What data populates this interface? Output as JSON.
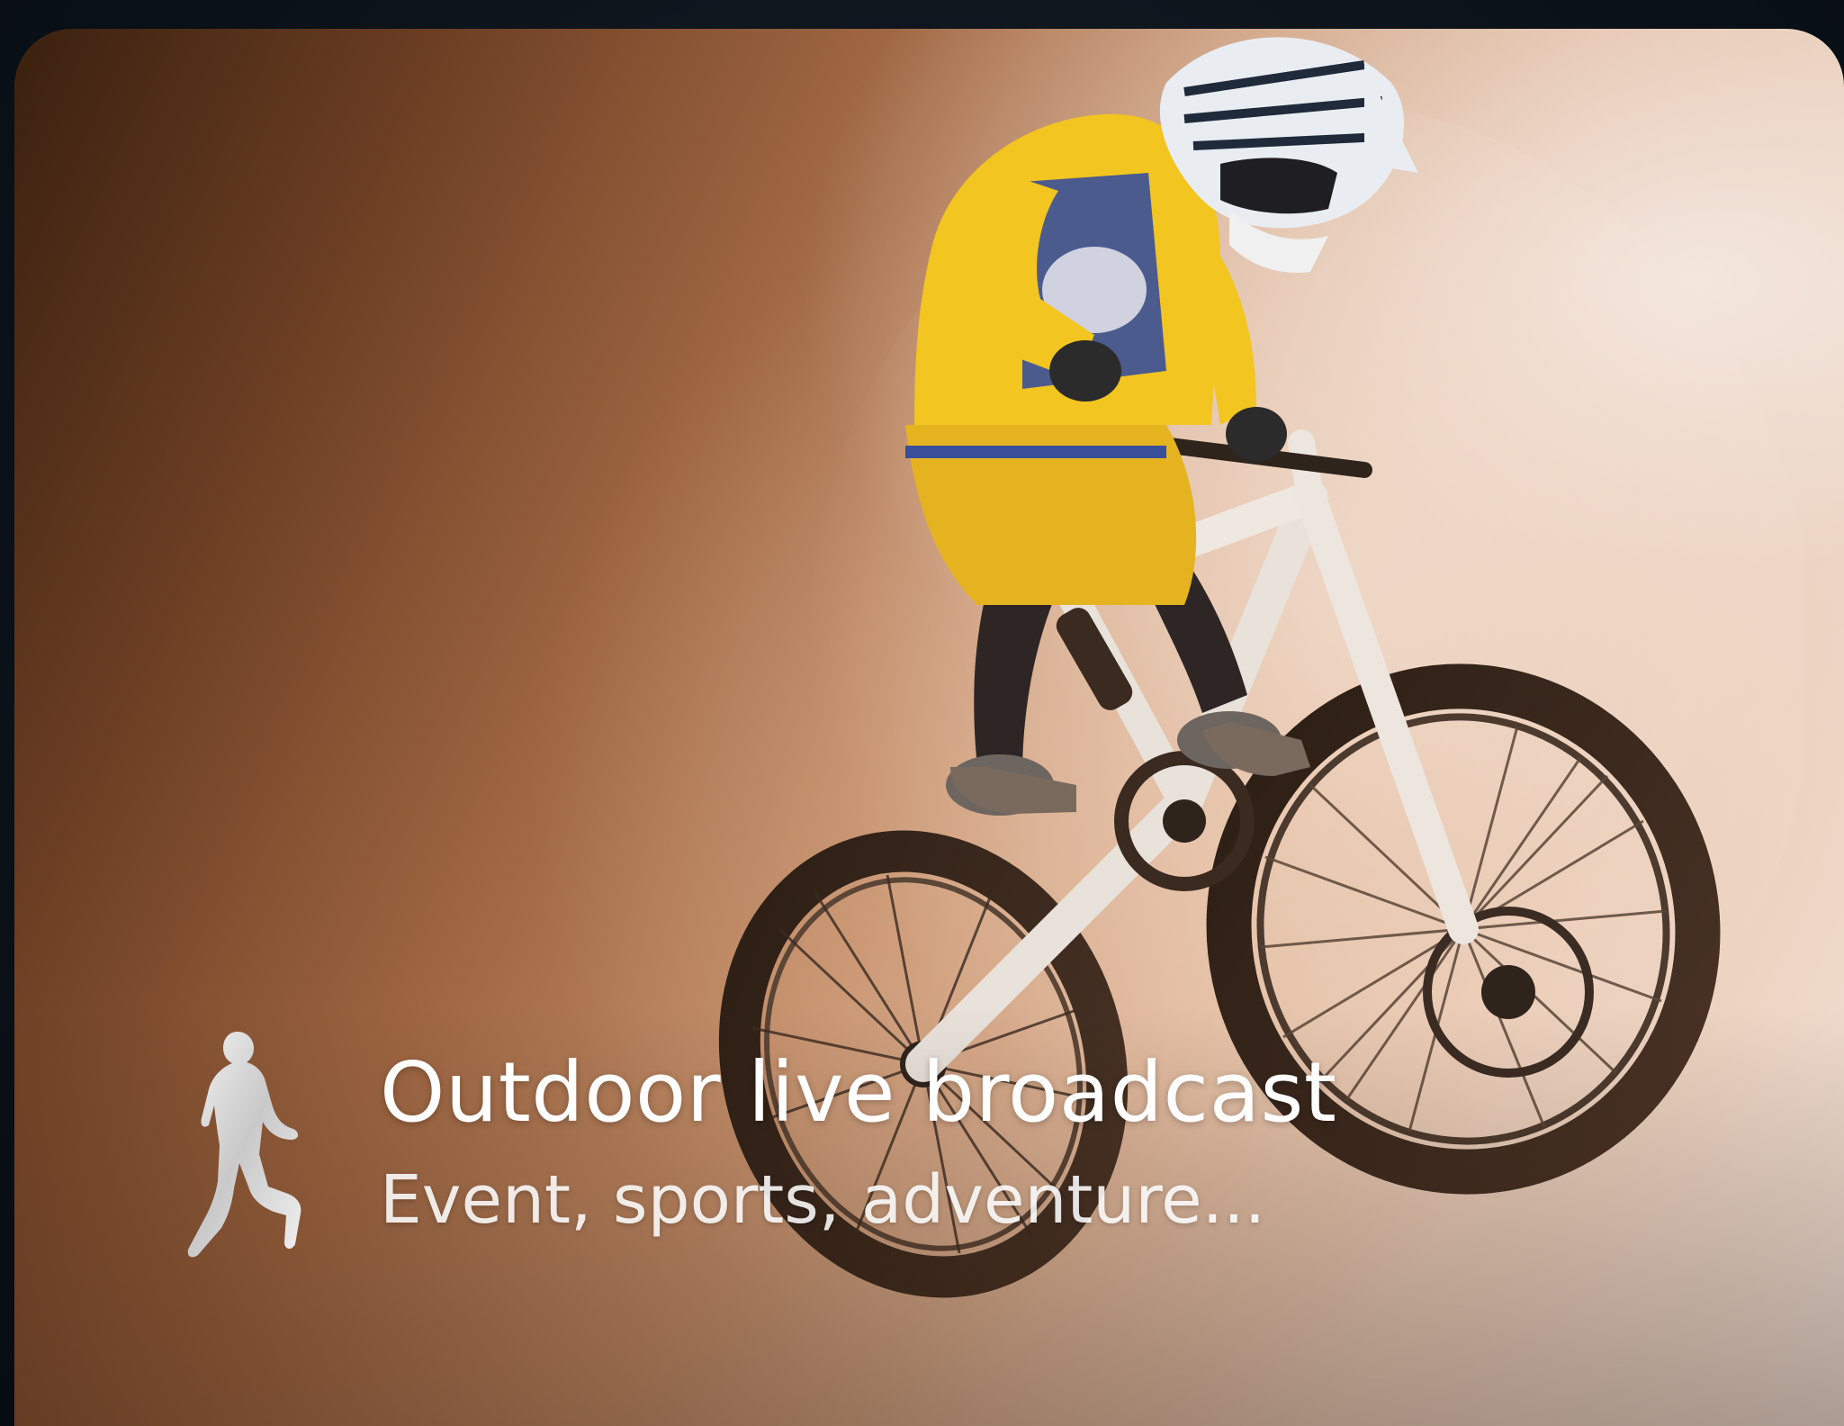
{
  "card": {
    "title": "Outdoor live broadcast",
    "subtitle": "Event, sports, adventure...",
    "icon": "runner-icon",
    "image": "mountain-biker-jump-photo"
  },
  "colors": {
    "background": "#0c131b",
    "card_dark": "#3a200f",
    "card_mid": "#c28c67",
    "card_light": "#f2e4da",
    "jersey_yellow": "#f2c521",
    "jersey_blue": "#3a4f9a",
    "text": "#ffffff"
  }
}
